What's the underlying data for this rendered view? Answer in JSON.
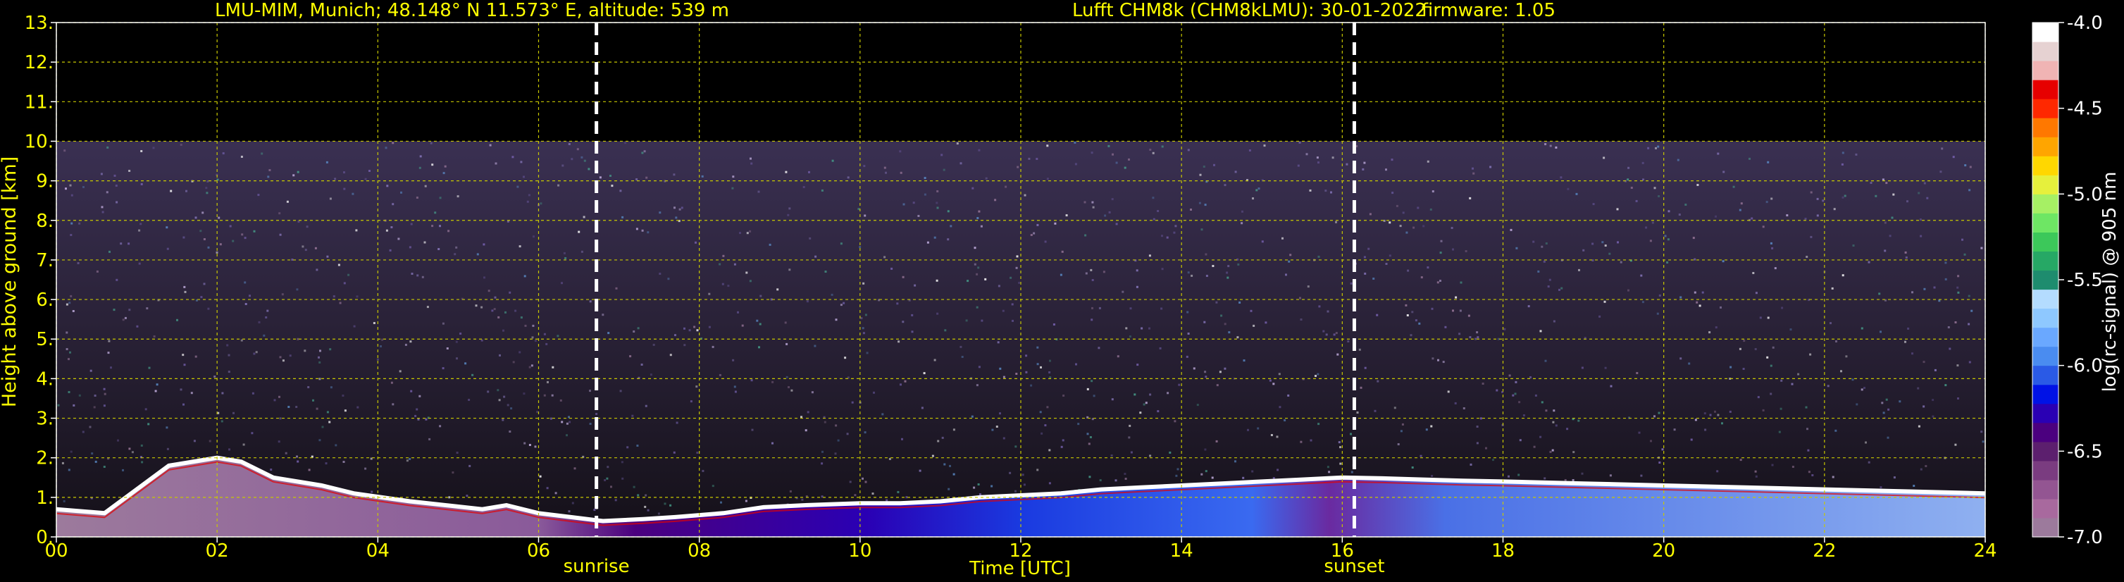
{
  "title": {
    "station": "LMU-MIM, Munich; 48.148° N 11.573° E, altitude: 539 m",
    "instrument": "Lufft CHM8k (CHM8kLMU): 30-01-2022",
    "firmware": "firmware: 1.05"
  },
  "colorbar": {
    "label": "log(rc-signal) @ 905 nm",
    "ticks": [
      "-4.0",
      "-4.5",
      "-5.0",
      "-5.5",
      "-6.0",
      "-6.5",
      "-7.0"
    ],
    "tick_values": [
      -4.0,
      -4.5,
      -5.0,
      -5.5,
      -6.0,
      -6.5,
      -7.0
    ],
    "range": [
      -7.0,
      -4.0
    ],
    "colors": [
      "#9c7a9c",
      "#a8699e",
      "#935592",
      "#7a3c80",
      "#5c1f6e",
      "#4b007f",
      "#2a00b4",
      "#0012e6",
      "#2a5ae6",
      "#4a8cf0",
      "#6aa8ff",
      "#8ec8ff",
      "#b4dcff",
      "#1e8c6e",
      "#26a865",
      "#3cc85a",
      "#6ee664",
      "#a6f064",
      "#e6f03c",
      "#ffd700",
      "#ffa500",
      "#ff7800",
      "#ff2800",
      "#e60000",
      "#f0b4b4",
      "#e6d2d2",
      "#ffffff"
    ]
  },
  "markers": [
    {
      "label": "sunrise",
      "time": 6.72
    },
    {
      "label": "sunset",
      "time": 16.15
    }
  ],
  "chart_data": {
    "type": "heatmap",
    "title": "LMU-MIM, Munich; 48.148° N 11.573° E, altitude: 539 m    Lufft CHM8k (CHM8kLMU): 30-01-2022    firmware: 1.05",
    "xlabel": "Time [UTC]",
    "ylabel": "Height above ground [km]",
    "xlim": [
      0,
      24
    ],
    "ylim": [
      0,
      13
    ],
    "x_ticks": [
      "00",
      "02",
      "04",
      "06",
      "08",
      "10",
      "12",
      "14",
      "16",
      "18",
      "20",
      "22",
      "24"
    ],
    "y_ticks": [
      "0.",
      "1.",
      "2.",
      "3.",
      "4.",
      "5.",
      "6.",
      "7.",
      "8.",
      "9.",
      "10.",
      "11.",
      "12.",
      "13."
    ],
    "grid": true,
    "data_top_km": 10,
    "colorbar_label": "log(rc-signal) @ 905 nm",
    "boundary_layer_top": {
      "time": [
        0,
        0.6,
        1.4,
        2.0,
        2.3,
        2.7,
        3.3,
        3.7,
        4.4,
        5.3,
        5.6,
        6.0,
        6.4,
        6.8,
        7.3,
        7.7,
        8.3,
        8.8,
        9.3,
        10.0,
        10.5,
        11.0,
        11.5,
        12.0,
        12.5,
        13.0,
        13.5,
        14.0,
        14.5,
        15.0,
        15.5,
        16.0,
        16.5,
        17.0,
        17.5,
        18.0,
        19.0,
        20.0,
        21.0,
        22.0,
        23.0,
        24.0
      ],
      "height_km": [
        0.7,
        0.6,
        1.8,
        2.0,
        1.9,
        1.5,
        1.3,
        1.1,
        0.9,
        0.7,
        0.8,
        0.6,
        0.5,
        0.4,
        0.45,
        0.5,
        0.6,
        0.75,
        0.8,
        0.85,
        0.85,
        0.9,
        1.0,
        1.05,
        1.1,
        1.2,
        1.25,
        1.3,
        1.35,
        1.4,
        1.45,
        1.5,
        1.48,
        1.45,
        1.42,
        1.4,
        1.35,
        1.3,
        1.25,
        1.2,
        1.15,
        1.1
      ]
    }
  }
}
